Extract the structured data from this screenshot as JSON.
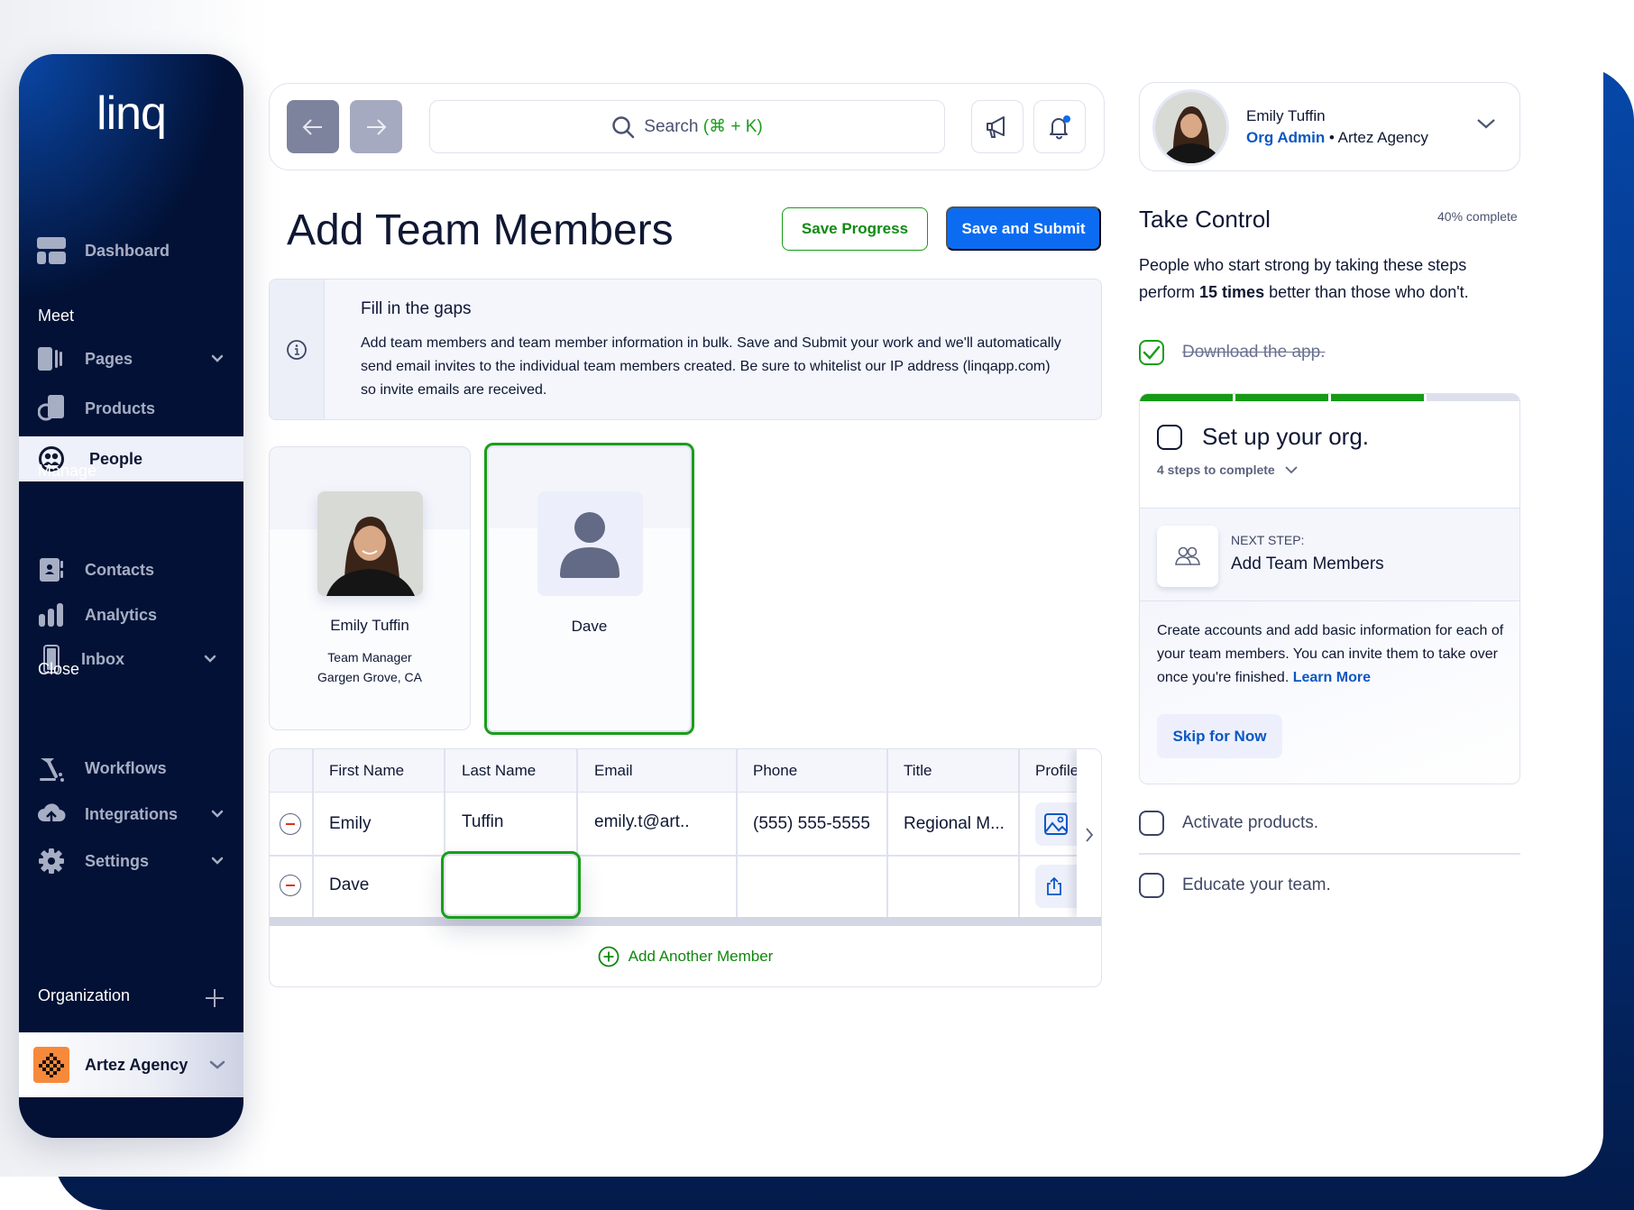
{
  "sidebar": {
    "logo": "linq",
    "dashboard": "Dashboard",
    "sections": {
      "meet": "Meet",
      "manage": "Manage",
      "close": "Close",
      "organization": "Organization"
    },
    "items": [
      {
        "label": "Pages",
        "icon": "pages-icon",
        "has_chevron": true
      },
      {
        "label": "Products",
        "icon": "products-icon",
        "has_chevron": false
      },
      {
        "label": "People",
        "icon": "people-icon",
        "active": true
      },
      {
        "label": "Contacts",
        "icon": "contacts-icon"
      },
      {
        "label": "Analytics",
        "icon": "analytics-icon"
      },
      {
        "label": "Inbox",
        "icon": "phone-icon",
        "has_chevron": true
      },
      {
        "label": "Workflows",
        "icon": "workflows-icon"
      },
      {
        "label": "Integrations",
        "icon": "cloud-upload-icon",
        "has_chevron": true
      },
      {
        "label": "Settings",
        "icon": "gear-icon",
        "has_chevron": true
      }
    ],
    "org_name": "Artez Agency"
  },
  "header": {
    "search_label": "Search",
    "search_shortcut": "(⌘ + K)"
  },
  "page": {
    "title": "Add Team Members",
    "save_progress": "Save Progress",
    "save_submit": "Save and Submit",
    "info_title": "Fill in the gaps",
    "info_body": "Add team members and team member information in bulk. Save and Submit your work and we'll automatically send email invites to the individual team members created. Be sure to whitelist our IP address (linqapp.com) so invite emails are received."
  },
  "cards": [
    {
      "name": "Emily Tuffin",
      "role": "Team Manager",
      "location": "Gargen Grove, CA"
    },
    {
      "name": "Dave",
      "role": "",
      "location": ""
    }
  ],
  "table": {
    "columns": [
      "First Name",
      "Last Name",
      "Email",
      "Phone",
      "Title",
      "Profile"
    ],
    "rows": [
      {
        "first": "Emily",
        "last": "Tuffin",
        "email": "emily.t@art..",
        "phone": "(555) 555-5555",
        "title": "Regional M..."
      },
      {
        "first": "Dave",
        "last": "",
        "email": "",
        "phone": "",
        "title": ""
      }
    ],
    "add_member": "Add Another Member"
  },
  "profile": {
    "name": "Emily Tuffin",
    "role": "Org Admin",
    "org": "Artez Agency"
  },
  "take_control": {
    "title": "Take Control",
    "progress_text": "40% complete",
    "progress_fraction": 0.4,
    "desc_pre": "People who start strong by taking these steps perform ",
    "desc_bold": "15 times",
    "desc_post": " better than those who don't.",
    "tasks": [
      {
        "label": "Download the app.",
        "done": true
      },
      {
        "label": "Set up your org.",
        "done": false,
        "sub": "4 steps to complete",
        "steps_done": 3,
        "steps_total": 4
      },
      {
        "label": "Activate products.",
        "done": false
      },
      {
        "label": "Educate your team.",
        "done": false
      }
    ],
    "next_step_label": "NEXT STEP:",
    "next_step_title": "Add Team Members",
    "step_desc": "Create accounts and add basic information for each of your team members. You can invite them to take over once you're finished.",
    "learn_more": "Learn More",
    "skip": "Skip for Now"
  },
  "colors": {
    "navy": "#021135",
    "accent_blue": "#0b6cf2",
    "success_green": "#1a9e1a",
    "danger_red": "#e0311f",
    "org_orange": "#f7893b"
  }
}
